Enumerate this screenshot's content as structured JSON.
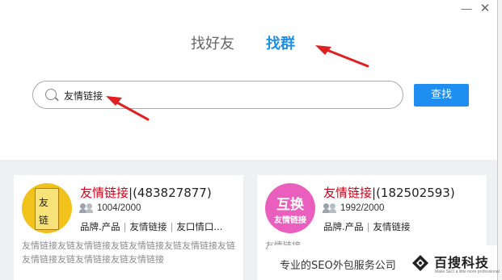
{
  "window": {
    "minimize_glyph": "—",
    "close_glyph": "✕"
  },
  "tabs": {
    "find_friend": "找好友",
    "find_group": "找群",
    "active": "find_group"
  },
  "search": {
    "value": "友情链接",
    "button_label": "查找"
  },
  "results": [
    {
      "name": "友情链接",
      "id_text": "(483827877)",
      "members": "1004/2000",
      "tags": [
        "品牌.产品",
        "友情链接",
        "友口情口..."
      ],
      "description": "友情链接友链友情链接友链友情链接友链友情链接友链友情链接友链友情链接友链友情链接",
      "avatar": {
        "type": "calligraphy",
        "chars": [
          "友",
          "链"
        ]
      }
    },
    {
      "name": "友情链接",
      "id_text": "(182502593)",
      "members": "1992/2000",
      "tags": [
        "品牌.产品",
        "友情链接"
      ],
      "description": "友情链接",
      "avatar": {
        "type": "badge",
        "big_text": "互换",
        "small_text": "友情链接"
      }
    }
  ],
  "watermark": {
    "text": "专业的SEO外包服务公司",
    "brand": "百搜科技",
    "sub": "Make SEO a little more professional"
  },
  "colors": {
    "accent": "#1e8ef0",
    "group_name": "#d0021b",
    "arrow": "#e02020"
  }
}
